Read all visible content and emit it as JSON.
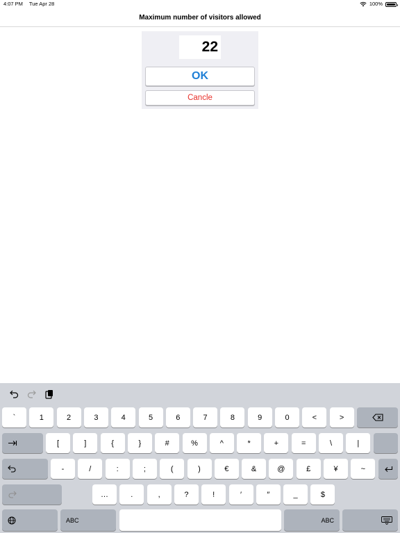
{
  "status_bar": {
    "time": "4:07 PM",
    "date": "Tue Apr 28",
    "battery": "100%"
  },
  "nav": {
    "title": "Maximum number of visitors allowed"
  },
  "dialog": {
    "value": "22",
    "ok_label": "OK",
    "cancel_label": "Cancle"
  },
  "colors": {
    "ok": "#1e7fd6",
    "cancel": "#e8302a",
    "keyboard_bg": "#d1d4da",
    "key_dark": "#adb3bc"
  },
  "keyboard": {
    "toolbar_icons": [
      "undo-icon",
      "redo-icon",
      "paste-icon"
    ],
    "row1": [
      "`",
      "1",
      "2",
      "3",
      "4",
      "5",
      "6",
      "7",
      "8",
      "9",
      "0",
      "<",
      ">"
    ],
    "row2": [
      "[",
      "]",
      "{",
      "}",
      "#",
      "%",
      "^",
      "*",
      "+",
      "=",
      "\\",
      "|"
    ],
    "row3": [
      "-",
      "/",
      ":",
      ";",
      "(",
      ")",
      "€",
      "&",
      "@",
      "£",
      "¥",
      "~"
    ],
    "row4": [
      "…",
      ".",
      ",",
      "?",
      "!",
      "′",
      "″",
      "_",
      "$"
    ],
    "abc_left": "ABC",
    "abc_right": "ABC"
  }
}
